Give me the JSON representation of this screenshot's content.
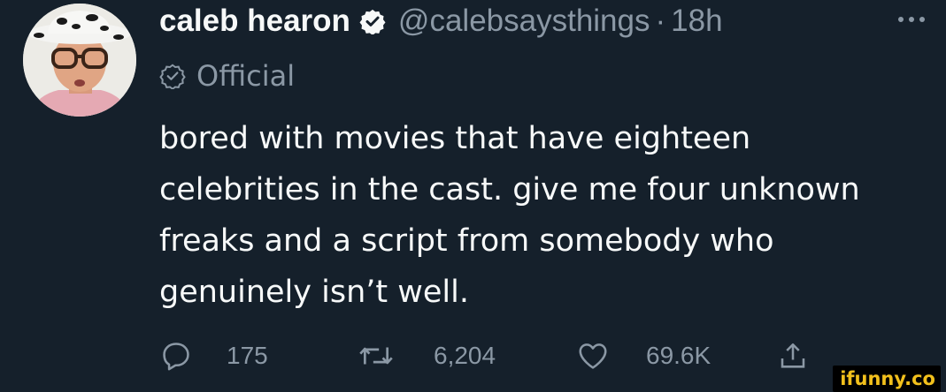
{
  "tweet": {
    "author": {
      "name": "caleb hearon",
      "handle": "@calebsaysthings",
      "separator": "·",
      "time": "18h",
      "verified": true
    },
    "label": "Official",
    "text_lines": [
      "bored with movies that have eighteen",
      "celebrities in the cast. give me four unknown",
      "freaks and a script from somebody who",
      "genuinely isn’t well."
    ],
    "stats": {
      "replies": "175",
      "retweets": "6,204",
      "likes": "69.6K"
    }
  },
  "icons": {
    "verified": "verified-badge-icon",
    "label": "official-label-icon",
    "more": "more-options-icon",
    "reply": "reply-icon",
    "retweet": "retweet-icon",
    "like": "heart-icon",
    "share": "share-icon"
  },
  "colors": {
    "background": "#15202b",
    "text_primary": "#f7f9f9",
    "text_secondary": "#8b98a5",
    "watermark": "#f2c01c"
  },
  "watermark": "ifunny.co"
}
